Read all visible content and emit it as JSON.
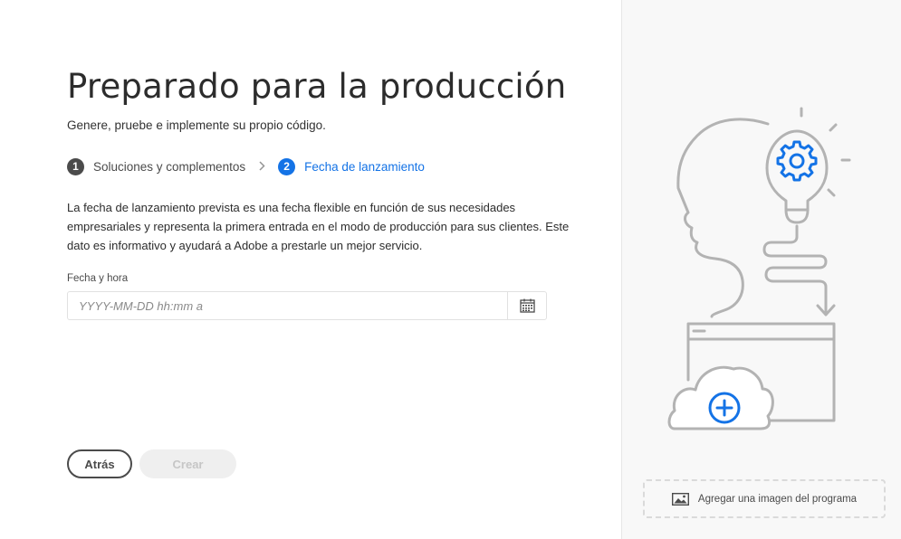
{
  "page": {
    "title": "Preparado para la producción",
    "subtitle": "Genere, pruebe e implemente su propio código."
  },
  "steps": [
    {
      "number": "1",
      "label": "Soluciones y complementos",
      "state": "done"
    },
    {
      "number": "2",
      "label": "Fecha de lanzamiento",
      "state": "active"
    }
  ],
  "description": "La fecha de lanzamiento prevista es una fecha flexible en función de sus necesidades empresariales y representa la primera entrada en el modo de producción para sus clientes. Este dato es informativo y ayudará a Adobe a prestarle un mejor servicio.",
  "date_field": {
    "label": "Fecha y hora",
    "placeholder": "YYYY-MM-DD hh:mm a",
    "value": "",
    "icon": "calendar-icon"
  },
  "buttons": {
    "back_label": "Atrás",
    "create_label": "Crear"
  },
  "side_panel": {
    "add_image_label": "Agregar una imagen del programa",
    "add_image_icon": "image-icon"
  },
  "colors": {
    "accent": "#1473e6",
    "illustration_gray": "#b3b3b3",
    "step_done": "#4b4b4b"
  }
}
